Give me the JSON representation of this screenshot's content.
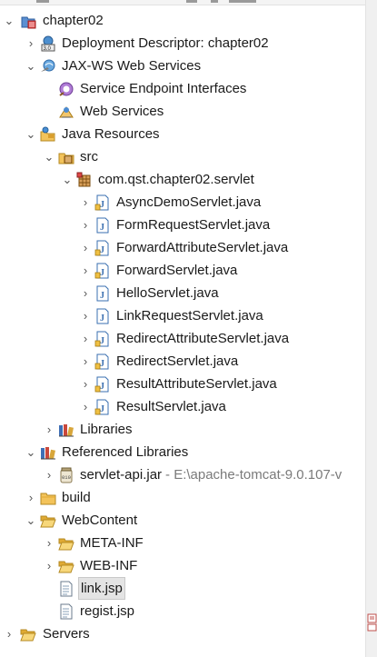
{
  "tree": {
    "project": {
      "label": "chapter02",
      "icon": "dynamic-web-project-icon"
    },
    "deployment_descriptor": {
      "label": "Deployment Descriptor: chapter02",
      "icon": "deployment-descriptor-icon"
    },
    "jaxws": {
      "label": "JAX-WS Web Services",
      "icon": "jaxws-icon",
      "children": [
        {
          "label": "Service Endpoint Interfaces",
          "icon": "sei-icon"
        },
        {
          "label": "Web Services",
          "icon": "web-services-icon"
        }
      ]
    },
    "java_resources": {
      "label": "Java Resources",
      "icon": "java-resources-icon"
    },
    "src": {
      "label": "src",
      "icon": "source-folder-icon"
    },
    "package": {
      "label": "com.qst.chapter02.servlet",
      "icon": "package-icon"
    },
    "java_files": [
      "AsyncDemoServlet.java",
      "FormRequestServlet.java",
      "ForwardAttributeServlet.java",
      "ForwardServlet.java",
      "HelloServlet.java",
      "LinkRequestServlet.java",
      "RedirectAttributeServlet.java",
      "RedirectServlet.java",
      "ResultAttributeServlet.java",
      "ResultServlet.java"
    ],
    "libraries": {
      "label": "Libraries",
      "icon": "libraries-icon"
    },
    "referenced_libraries": {
      "label": "Referenced Libraries",
      "icon": "referenced-libraries-icon"
    },
    "servlet_api": {
      "label": "servlet-api.jar",
      "decoration": "- E:\\apache-tomcat-9.0.107-v",
      "icon": "jar-icon"
    },
    "build": {
      "label": "build",
      "icon": "folder-icon"
    },
    "webcontent": {
      "label": "WebContent",
      "icon": "folder-open-icon"
    },
    "meta_inf": {
      "label": "META-INF",
      "icon": "folder-icon"
    },
    "web_inf": {
      "label": "WEB-INF",
      "icon": "folder-icon"
    },
    "link_jsp": {
      "label": "link.jsp",
      "icon": "jsp-file-icon",
      "selected": true
    },
    "regist_jsp": {
      "label": "regist.jsp",
      "icon": "jsp-file-icon"
    },
    "servers": {
      "label": "Servers",
      "icon": "folder-open-icon"
    }
  },
  "colors": {
    "selection_bg": "#e4e4e4",
    "folder_fill": "#f3c35a",
    "java_blue": "#3a6fb0",
    "decoration_gray": "#7a7a7a"
  }
}
